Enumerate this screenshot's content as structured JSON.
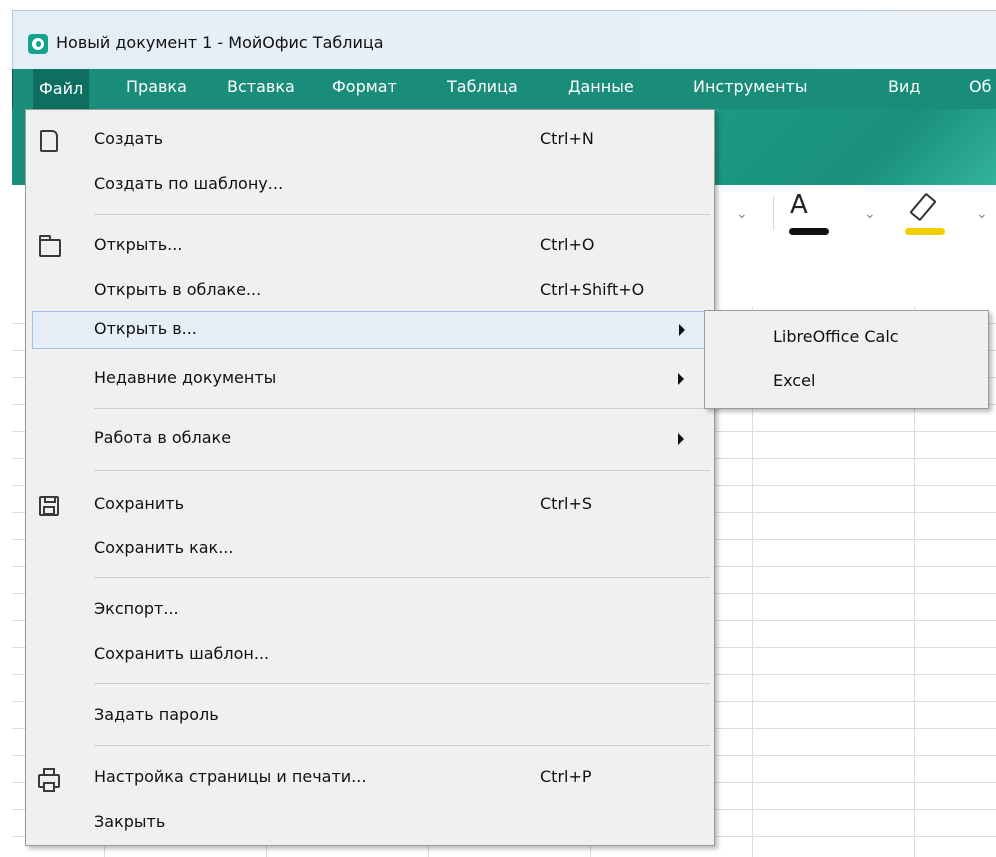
{
  "window": {
    "title": "Новый документ 1 - МойОфис Таблица",
    "accent": "#1a8d7a"
  },
  "menubar": {
    "items": [
      "Файл",
      "Правка",
      "Вставка",
      "Формат",
      "Таблица",
      "Данные",
      "Инструменты",
      "Вид",
      "Об"
    ],
    "active_index": 0
  },
  "toolbar": {
    "font_color_label": "A",
    "font_color": "#111111",
    "highlight_color": "#f2d000"
  },
  "file_menu": {
    "items": [
      {
        "label": "Создать",
        "shortcut": "Ctrl+N",
        "icon": "new-file-icon"
      },
      {
        "label": "Создать по шаблону...",
        "shortcut": ""
      },
      {
        "label": "Открыть...",
        "shortcut": "Ctrl+O",
        "icon": "folder-open-icon"
      },
      {
        "label": "Открыть в облаке...",
        "shortcut": "Ctrl+Shift+O"
      },
      {
        "label": "Открыть в...",
        "shortcut": "",
        "submenu": true,
        "highlighted": true
      },
      {
        "label": "Недавние документы",
        "shortcut": "",
        "submenu": true
      },
      {
        "label": "Работа в облаке",
        "shortcut": "",
        "submenu": true
      },
      {
        "label": "Сохранить",
        "shortcut": "Ctrl+S",
        "icon": "save-icon"
      },
      {
        "label": "Сохранить как...",
        "shortcut": ""
      },
      {
        "label": "Экспорт...",
        "shortcut": ""
      },
      {
        "label": "Сохранить шаблон...",
        "shortcut": ""
      },
      {
        "label": "Задать пароль",
        "shortcut": ""
      },
      {
        "label": "Настройка страницы и печати...",
        "shortcut": "Ctrl+P",
        "icon": "print-icon"
      },
      {
        "label": "Закрыть",
        "shortcut": ""
      }
    ]
  },
  "open_in_submenu": {
    "items": [
      "LibreOffice Calc",
      "Excel"
    ]
  }
}
